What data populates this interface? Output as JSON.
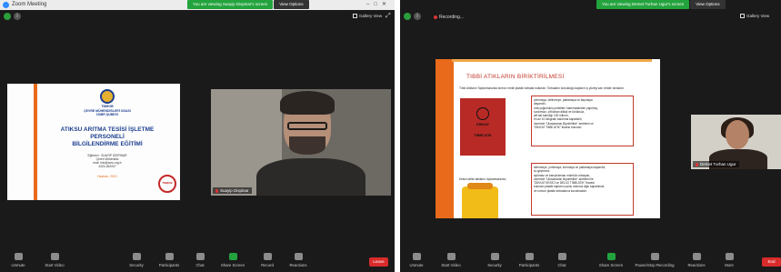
{
  "left": {
    "window_title": "Zoom Meeting",
    "viewing_text": "You are viewing Suayip Dispinar's screen",
    "view_options": "View Options",
    "gallery_view": "Gallery View",
    "slide": {
      "org_line1": "TMMOB",
      "org_line2": "ÇEVRE MÜHENDİSLERİ ODASI",
      "org_line3": "İZMİR ŞUBESİ",
      "title_line1": "ATIKSU ARITMA TESİSİ İŞLETME",
      "title_line2": "PERSONELİ",
      "title_line3": "BİLGİLENDİRME EĞİTİMİ",
      "presenter_label": "Eğitmen : SUAYİP DİSPINAR",
      "presenter_role": "Çevre Mühendisi",
      "email": "mail: info@cmo.org.tr",
      "phone": "4324-262007",
      "date": "Haziran, 2021",
      "stamp": "TMMOB"
    },
    "participant_name": "Suayip Dispinar",
    "toolbar": [
      {
        "label": "Unmute",
        "icon": "microphone-muted-icon"
      },
      {
        "label": "Start Video",
        "icon": "video-off-icon"
      },
      {
        "label": "Security",
        "icon": "shield-icon"
      },
      {
        "label": "Participants",
        "icon": "participants-icon",
        "count": "13"
      },
      {
        "label": "Chat",
        "icon": "chat-icon"
      },
      {
        "label": "Share Screen",
        "icon": "share-screen-icon"
      },
      {
        "label": "Record",
        "icon": "record-icon"
      },
      {
        "label": "Reactions",
        "icon": "reactions-icon"
      }
    ],
    "leave": "Leave"
  },
  "right": {
    "viewing_text": "You are viewing Demet Turhan Ugur's screen",
    "view_options": "View Options",
    "recording": "Recording...",
    "gallery_view": "Gallery View",
    "slide": {
      "title": "TIBBİ ATIKLARIN BİRİKTİRİLMESİ",
      "intro": "Tıbbi Atıkların Toplanmasında kırmızı renkli plastik torbalar kullanılır. Torbaların konulduğu kapların iç yüzeyi sarı renkte olmalıdır.",
      "red_box_line1": "DİKKAT",
      "red_box_line2": "TIBBİ ATIK",
      "box1_lines": [
        "yırtılmaya, delinmeye, patlamaya ve taşımaya",
        "dayanıklı,",
        "orta yoğunluklu polietilen hammaddeden yapılmış,",
        "sızdırmaz, çift taban dikişli ve körüksüz,",
        "çift kat kalınlığı 100 mikron,",
        "en az 10 kilogram kaldırma kapasiteli,",
        "üzerinde \"Uluslararası Biyotehlike\" amblemi ve",
        "\"DİKKAT TIBBİ ATIK\" ibaresi bulunan"
      ],
      "sharps_label": "Kesici-delici atıkların toplanmasında;",
      "box2_lines": [
        "delinmeye, yırtılmaya, kırılmaya ve patlamaya dayanıklı,",
        "su geçirmez,",
        "açılması ve karıştırılması mümkün olmayan,",
        "üzerinde \"Uluslararası Biyotehlike\" amblemi ile",
        "\"DİKKAT KESİCİ ve DELİCİ TIBBİ ATIK\" ibaresi",
        "bulunan plastik kapların yarısı dolunca ağzı kapatılmalı",
        "ve kırmızı plastik torbalarına konulmalıdır."
      ]
    },
    "participant_name": "Demet Turhan Ugur",
    "toolbar": [
      {
        "label": "Unmute",
        "icon": "microphone-muted-icon"
      },
      {
        "label": "Start Video",
        "icon": "video-off-icon"
      },
      {
        "label": "Security",
        "icon": "shield-icon"
      },
      {
        "label": "Participants",
        "icon": "participants-icon",
        "count": "14"
      },
      {
        "label": "Chat",
        "icon": "chat-icon"
      },
      {
        "label": "Share Screen",
        "icon": "share-screen-icon"
      },
      {
        "label": "Pause/Stop Recording",
        "icon": "pause-stop-recording-icon"
      },
      {
        "label": "Reactions",
        "icon": "reactions-icon"
      },
      {
        "label": "More",
        "icon": "more-icon"
      }
    ],
    "leave": "End"
  },
  "colors": {
    "zoom_dark": "#1a1a1a",
    "viewing_green": "#23a33d",
    "leave_red": "#d92b2b",
    "slide_accent": "#e86a1a",
    "slide_title_blue": "#1d3f8f"
  }
}
